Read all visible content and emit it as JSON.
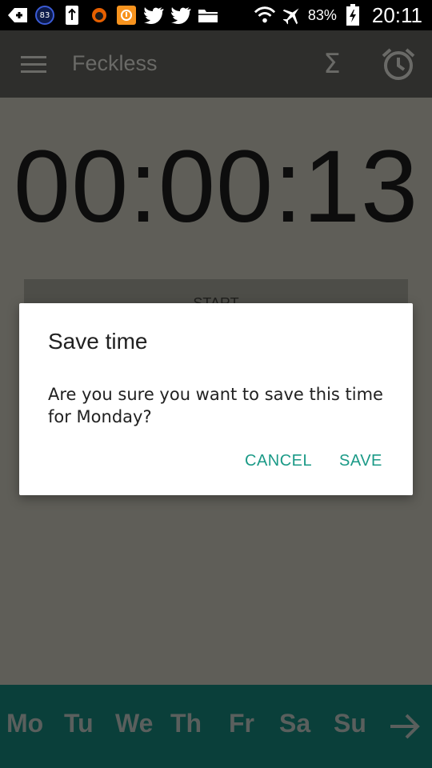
{
  "status_bar": {
    "notification_badge": "83",
    "battery_percent": "83%",
    "time": "20:11",
    "icons": [
      "back-notify-icon",
      "badge-83-icon",
      "usb-icon",
      "firefox-icon",
      "download-icon",
      "twitter-icon",
      "twitter-icon",
      "folder-icon",
      "wifi-icon",
      "airplane-icon",
      "battery-icon"
    ]
  },
  "app_bar": {
    "title": "Feckless"
  },
  "timer": {
    "display": "00:00:13"
  },
  "start_button": {
    "label": "START"
  },
  "dialog": {
    "title": "Save time",
    "message": "Are you sure you want to save this time for Monday?",
    "cancel_label": "CANCEL",
    "save_label": "SAVE"
  },
  "day_bar": {
    "days": [
      "Mo",
      "Tu",
      "We",
      "Th",
      "Fr",
      "Sa",
      "Su"
    ]
  },
  "colors": {
    "accent": "#1b9a87",
    "day_bar_bg": "#0a3f3a",
    "app_bar_bg": "#2e2e2c",
    "scrim_bg": "#5f5e58"
  }
}
